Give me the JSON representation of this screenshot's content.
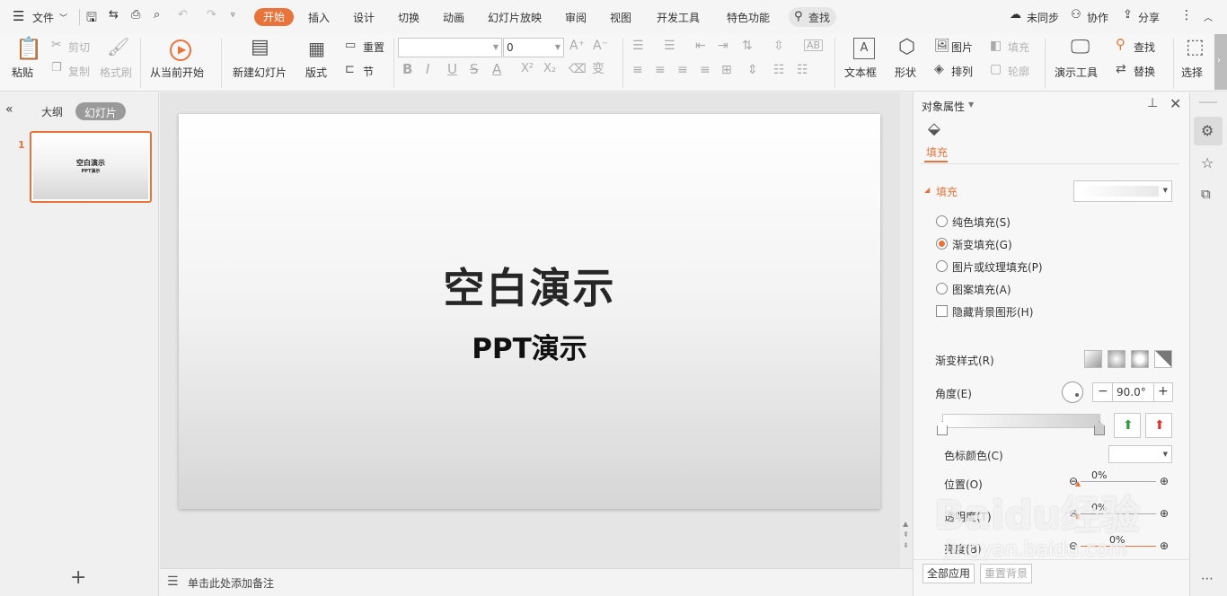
{
  "menu": {
    "file": "文件",
    "tabs": [
      "开始",
      "插入",
      "设计",
      "切换",
      "动画",
      "幻灯片放映",
      "审阅",
      "视图",
      "开发工具",
      "特色功能"
    ],
    "active_tab": "开始",
    "search": "查找",
    "sync": "未同步",
    "collab": "协作",
    "share": "分享"
  },
  "ribbon": {
    "paste": "粘贴",
    "cut": "剪切",
    "copy": "复制",
    "format_painter": "格式刷",
    "from_current": "从当前开始",
    "new_slide": "新建幻灯片",
    "layout": "版式",
    "reset": "重置",
    "section": "节",
    "font_size": "0",
    "textbox": "文本框",
    "shape": "形状",
    "picture": "图片",
    "fill": "填充",
    "arrange": "排列",
    "outline": "轮廓",
    "presenter_tools": "演示工具",
    "find": "查找",
    "replace": "替换",
    "select": "选择"
  },
  "left_pane": {
    "outline_tab": "大纲",
    "slides_tab": "幻灯片",
    "slide_number": "1",
    "thumb_title": "空白演示",
    "thumb_subtitle": "PPT演示"
  },
  "slide": {
    "title": "空白演示",
    "subtitle": "PPT演示"
  },
  "notes": {
    "placeholder": "单击此处添加备注"
  },
  "properties": {
    "header": "对象属性",
    "tab_fill": "填充",
    "section_fill": "填充",
    "options": [
      "纯色填充(S)",
      "渐变填充(G)",
      "图片或纹理填充(P)",
      "图案填充(A)"
    ],
    "selected_option": "渐变填充(G)",
    "hide_bg": "隐藏背景图形(H)",
    "gradient_style": "渐变样式(R)",
    "angle_label": "角度(E)",
    "angle_value": "90.0°",
    "stop_color": "色标颜色(C)",
    "position_label": "位置(O)",
    "position_value": "0%",
    "transparency_label": "透明度(T)",
    "transparency_value": "0%",
    "brightness_label": "亮度(B)",
    "brightness_value": "0%",
    "apply_all": "全部应用",
    "reset_bg": "重置背景"
  },
  "watermark": {
    "brand": "Baidu经验",
    "url": "jingyan.baidu.com"
  },
  "colors": {
    "accent": "#e8743b"
  }
}
